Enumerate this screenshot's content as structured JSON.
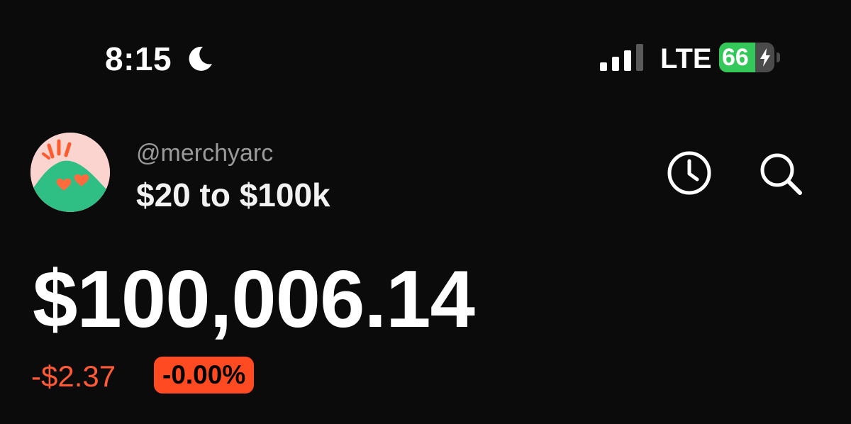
{
  "status_bar": {
    "time": "8:15",
    "focus_icon": "moon-icon",
    "network": "LTE",
    "battery_level": "66",
    "battery_fraction": 0.66,
    "battery_color": "#34c759",
    "charging": true
  },
  "header": {
    "handle": "@merchyarc",
    "portfolio_name": "$20 to $100k",
    "actions": [
      {
        "name": "history",
        "icon": "clock-icon"
      },
      {
        "name": "search",
        "icon": "search-icon"
      }
    ]
  },
  "balance": {
    "value": "$100,006.14",
    "change_amount": "-$2.37",
    "change_percent": "-0.00%",
    "negative_color": "#ff4a22"
  }
}
